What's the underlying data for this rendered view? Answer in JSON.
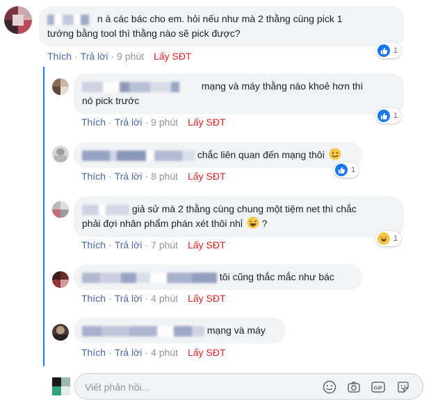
{
  "actions": {
    "like": "Thích",
    "reply": "Trả lời",
    "get_phone": "Lấy SĐT",
    "sep": "·"
  },
  "comments": [
    {
      "text_l1": "à các bác cho em. hỏi nếu như mà 2 thằng cùng pick 1",
      "text_l2": "tướng bằng tool thì thằng nào sẽ pick được?",
      "name_prefix": "n",
      "time": "9 phút",
      "reaction": {
        "type": "like",
        "count": "1"
      }
    },
    {
      "text_l1": "mạng và máy thằng nào khoẻ hơn thì",
      "text_l2": "nó pick trước",
      "time": "9 phút",
      "reaction": {
        "type": "like",
        "count": "1"
      }
    },
    {
      "text_l1": "chắc liên quan đến mạng thôi",
      "time": "8 phút",
      "reaction": {
        "type": "like",
        "count": "1"
      }
    },
    {
      "text_l1": "giả sử mà 2 thằng cùng chung một tiệm net thì chắc",
      "text_l2": "phải đợi nhân phẩm phán xét thôi nhỉ",
      "text_l2_end": "?",
      "time": "7 phút",
      "reaction": {
        "type": "haha",
        "count": "1"
      }
    },
    {
      "text_l1": "tôi cũng thắc mắc như bác",
      "time": "4 phút"
    },
    {
      "text_l1": "mạng và máy",
      "time": "4 phút"
    }
  ],
  "reply_input": {
    "placeholder": "Viết phản hồi..."
  },
  "icons": {
    "emoji": "emoji-icon",
    "camera": "camera-icon",
    "gif": "gif-icon",
    "sticker": "sticker-icon",
    "like": "like-icon",
    "haha": "haha-icon"
  },
  "colors": {
    "link": "#4b67a1",
    "sdt": "#e02020",
    "thread": "#1877f2",
    "like": "#1877f2",
    "bubble": "#f2f3f5"
  }
}
